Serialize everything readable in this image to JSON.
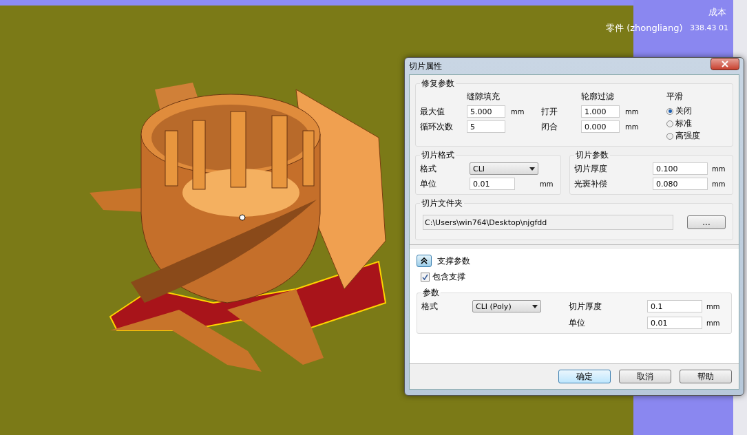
{
  "overlay": {
    "header": "成本",
    "part_label": "零件 (zhongliang)",
    "value": "338.43 01"
  },
  "dialog": {
    "title": "切片属性",
    "repair": {
      "title": "修复参数",
      "gap_header": "缝隙填充",
      "contour_header": "轮廓过滤",
      "smooth_header": "平滑",
      "rows": [
        {
          "label": "最大值",
          "value": "5.000",
          "unit": "mm",
          "label2": "打开",
          "value2": "1.000",
          "unit2": "mm"
        },
        {
          "label": "循环次数",
          "value": "5",
          "label2": "闭合",
          "value2": "0.000",
          "unit2": "mm"
        }
      ],
      "smoothing": [
        {
          "label": "关闭",
          "selected": true
        },
        {
          "label": "标准",
          "selected": false
        },
        {
          "label": "高强度",
          "selected": false
        }
      ]
    },
    "format": {
      "title": "切片格式",
      "format_label": "格式",
      "format_value": "CLI",
      "unit_label": "单位",
      "unit_value": "0.01",
      "unit": "mm"
    },
    "slice": {
      "title": "切片参数",
      "rows": [
        {
          "label": "切片厚度",
          "value": "0.100",
          "unit": "mm"
        },
        {
          "label": "光斑补偿",
          "value": "0.080",
          "unit": "mm"
        }
      ]
    },
    "folder": {
      "title": "切片文件夹",
      "path": "C:\\Users\\win764\\Desktop\\njgfdd",
      "browse": "..."
    },
    "support": {
      "title": "支撑参数",
      "expanded": true,
      "include_label": "包含支撑",
      "include_checked": true,
      "params_title": "参数",
      "format_label": "格式",
      "format_value": "CLI (Poly)",
      "rows": [
        {
          "label": "切片厚度",
          "value": "0.1",
          "unit": "mm"
        },
        {
          "label": "单位",
          "value": "0.01",
          "unit": "mm"
        }
      ]
    },
    "buttons": [
      {
        "label": "确定",
        "default": true
      },
      {
        "label": "取消",
        "default": false
      },
      {
        "label": "帮助",
        "default": false
      }
    ]
  }
}
